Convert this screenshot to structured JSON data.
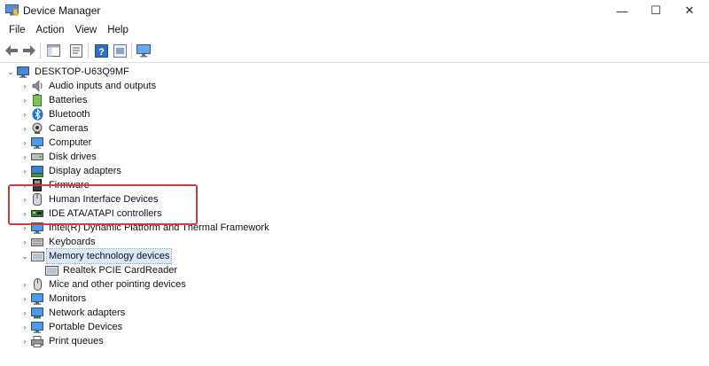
{
  "window": {
    "title": "Device Manager",
    "controls": {
      "minimize": "—",
      "maximize": "☐",
      "close": "✕"
    }
  },
  "menu": [
    "File",
    "Action",
    "View",
    "Help"
  ],
  "toolbar": {
    "buttons": [
      "back-icon",
      "forward-icon",
      "properties-icon",
      "update-driver-icon",
      "help-icon",
      "scan-hardware-icon"
    ]
  },
  "tree": {
    "root": {
      "label": "DESKTOP-U63Q9MF",
      "icon": "computer-icon",
      "expanded": true
    },
    "categories": [
      {
        "label": "Audio inputs and outputs",
        "icon": "speaker-icon"
      },
      {
        "label": "Batteries",
        "icon": "battery-icon"
      },
      {
        "label": "Bluetooth",
        "icon": "bluetooth-icon"
      },
      {
        "label": "Cameras",
        "icon": "camera-icon"
      },
      {
        "label": "Computer",
        "icon": "monitor-icon"
      },
      {
        "label": "Disk drives",
        "icon": "disk-icon"
      },
      {
        "label": "Display adapters",
        "icon": "display-adapter-icon"
      },
      {
        "label": "Firmware",
        "icon": "firmware-icon"
      },
      {
        "label": "Human Interface Devices",
        "icon": "hid-icon"
      },
      {
        "label": "IDE ATA/ATAPI controllers",
        "icon": "ide-controller-icon"
      },
      {
        "label": "Intel(R) Dynamic Platform and Thermal Framework",
        "icon": "thermal-icon"
      },
      {
        "label": "Keyboards",
        "icon": "keyboard-icon"
      },
      {
        "label": "Memory technology devices",
        "icon": "memory-card-icon",
        "expanded": true,
        "selected": true,
        "children": [
          {
            "label": "Realtek PCIE CardReader",
            "icon": "memory-card-icon"
          }
        ]
      },
      {
        "label": "Mice and other pointing devices",
        "icon": "mouse-icon"
      },
      {
        "label": "Monitors",
        "icon": "monitor-icon"
      },
      {
        "label": "Network adapters",
        "icon": "network-adapter-icon"
      },
      {
        "label": "Portable Devices",
        "icon": "portable-device-icon"
      },
      {
        "label": "Print queues",
        "icon": "printer-icon"
      }
    ]
  },
  "colors": {
    "highlight_box": "#d23b3b",
    "selection": "#d9e8fb"
  }
}
